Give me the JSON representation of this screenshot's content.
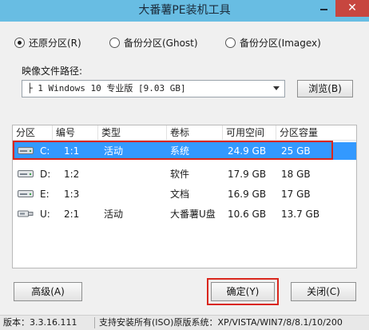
{
  "window": {
    "title": "大番薯PE装机工具",
    "minimize_symbol": "—",
    "close_symbol": "✕"
  },
  "modes": [
    {
      "label": "还原分区(R)",
      "selected": true
    },
    {
      "label": "备份分区(Ghost)",
      "selected": false
    },
    {
      "label": "备份分区(Imagex)",
      "selected": false
    }
  ],
  "image_path": {
    "label": "映像文件路径:",
    "value": "├ 1 Windows 10 专业版 [9.03 GB]",
    "browse_label": "浏览(B)"
  },
  "table": {
    "columns": [
      "分区",
      "编号",
      "类型",
      "卷标",
      "可用空间",
      "分区容量"
    ],
    "rows": [
      {
        "drive": "C:",
        "number": "1:1",
        "type": "活动",
        "label": "系统",
        "free": "24.9 GB",
        "capacity": "25 GB",
        "icon": "hard-disk-icon",
        "selected": true
      },
      {
        "drive": "D:",
        "number": "1:2",
        "type": "",
        "label": "软件",
        "free": "17.9 GB",
        "capacity": "18 GB",
        "icon": "hard-disk-icon",
        "selected": false
      },
      {
        "drive": "E:",
        "number": "1:3",
        "type": "",
        "label": "文档",
        "free": "16.9 GB",
        "capacity": "17 GB",
        "icon": "hard-disk-icon",
        "selected": false
      },
      {
        "drive": "U:",
        "number": "2:1",
        "type": "活动",
        "label": "大番薯U盘",
        "free": "10.6 GB",
        "capacity": "13.7 GB",
        "icon": "usb-drive-icon",
        "selected": false
      }
    ]
  },
  "buttons": {
    "advanced": "高级(A)",
    "ok": "确定(Y)",
    "close": "关闭(C)"
  },
  "status": {
    "version": "版本：3.3.16.111",
    "support": "支持安装所有(ISO)原版系统：XP/VISTA/WIN7/8/8.1/10/200"
  },
  "colors": {
    "titlebar": "#68bde3",
    "close": "#c7463f",
    "selection": "#3399ff",
    "highlight": "#d9261c"
  }
}
